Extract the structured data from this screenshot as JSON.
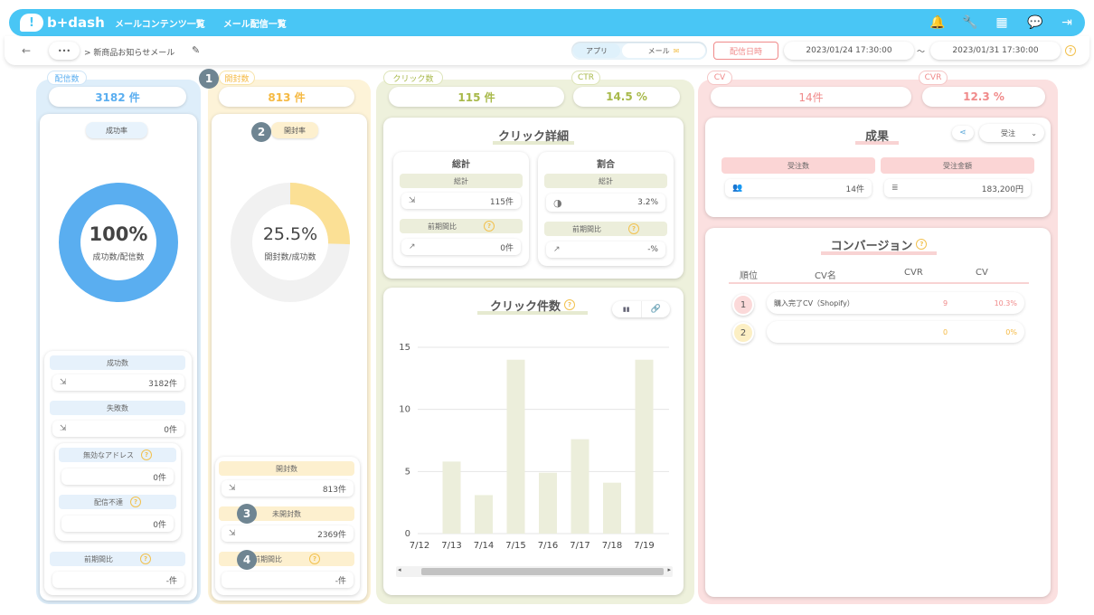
{
  "app": {
    "logo": "b+dash",
    "logo_glyph": "!"
  },
  "nav": {
    "link1": "メールコンテンツ一覧",
    "link2": "メール配信一覧"
  },
  "topicons": {
    "bell": "🔔",
    "wrench": "🔧",
    "grid": "▦",
    "chat": "💬",
    "logout": "⇥"
  },
  "subbar": {
    "back": "←",
    "more": "•••",
    "breadcrumb": "> 新商品お知らせメール",
    "edit": "✎",
    "toggle_app": "アプリ",
    "toggle_mail": "メール",
    "mail_icon": "✉",
    "date_label": "配信日時",
    "date_from": "2023/01/24 17:30:00",
    "tilde": "〜",
    "date_to": "2023/01/31 17:30:00",
    "help": "?"
  },
  "delivery": {
    "tab": "配信数",
    "value": "3182 件",
    "rate_label": "成功率",
    "donut_value": "100%",
    "donut_sub": "成功数/配信数",
    "success_label": "成功数",
    "success_value": "3182件",
    "fail_label": "失敗数",
    "fail_value": "0件",
    "invalid_label": "無効なアドレス",
    "invalid_value": "0件",
    "undeliv_label": "配信不達",
    "undeliv_value": "0件",
    "prev_label": "前期間比",
    "prev_value": "-件"
  },
  "open": {
    "badge1": "1",
    "tab": "開封数",
    "value": "813 件",
    "badge2": "2",
    "rate_label": "開封率",
    "donut_value": "25.5%",
    "donut_sub": "開封数/成功数",
    "rate": 0.255,
    "open_label": "開封数",
    "open_value": "813件",
    "badge3": "3",
    "unopen_label": "未開封数",
    "unopen_value": "2369件",
    "badge4": "4",
    "prev_label": "前期間比",
    "prev_value": "-件"
  },
  "click": {
    "tab": "クリック数",
    "value": "115 件",
    "ctr_tab": "CTR",
    "ctr_value": "14.5 %",
    "detail_title": "クリック詳細",
    "total_title": "総計",
    "total_hdr": "総計",
    "total_value": "115件",
    "total_prev_hdr": "前期間比",
    "total_prev_value": "0件",
    "ratio_title": "割合",
    "ratio_hdr": "総計",
    "ratio_value": "3.2%",
    "ratio_prev_hdr": "前期間比",
    "ratio_prev_value": "-%",
    "chart_title": "クリック件数",
    "bar_icon": "▮▮",
    "link_icon": "🔗"
  },
  "chart_data": {
    "type": "bar",
    "categories": [
      "7/12",
      "7/13",
      "7/14",
      "7/15",
      "7/16",
      "7/17",
      "7/18",
      "7/19"
    ],
    "values": [
      0,
      5.8,
      3.1,
      14,
      4.9,
      7.6,
      4.1,
      14
    ],
    "ylim": [
      0,
      15
    ],
    "yticks": [
      0,
      5,
      10,
      15
    ],
    "bar_color": "#eceedb"
  },
  "cv": {
    "tab": "CV",
    "value": "14件",
    "cvr_tab": "CVR",
    "cvr_value": "12.3 %",
    "result_title": "成果",
    "share_icon": "⋖",
    "select_value": "受注",
    "select_arrow": "⌄",
    "orders_label": "受注数",
    "orders_value": "14件",
    "amount_label": "受注金額",
    "amount_value": "183,200円",
    "conv_title": "コンバージョン",
    "col_rank": "順位",
    "col_name": "CV名",
    "col_cvr": "CVR",
    "col_cv": "CV",
    "rows": [
      {
        "rank": "1",
        "name": "購入完了CV（Shopify）",
        "cvr": "9",
        "cv": "10.3%"
      },
      {
        "rank": "2",
        "name": "",
        "cvr": "0",
        "cv": "0%"
      }
    ]
  },
  "colors": {
    "blue": "#5aaef0",
    "yellow": "#f5b942",
    "green": "#a8b94a",
    "pink": "#f08a8a",
    "accent": "#49c6f5"
  }
}
